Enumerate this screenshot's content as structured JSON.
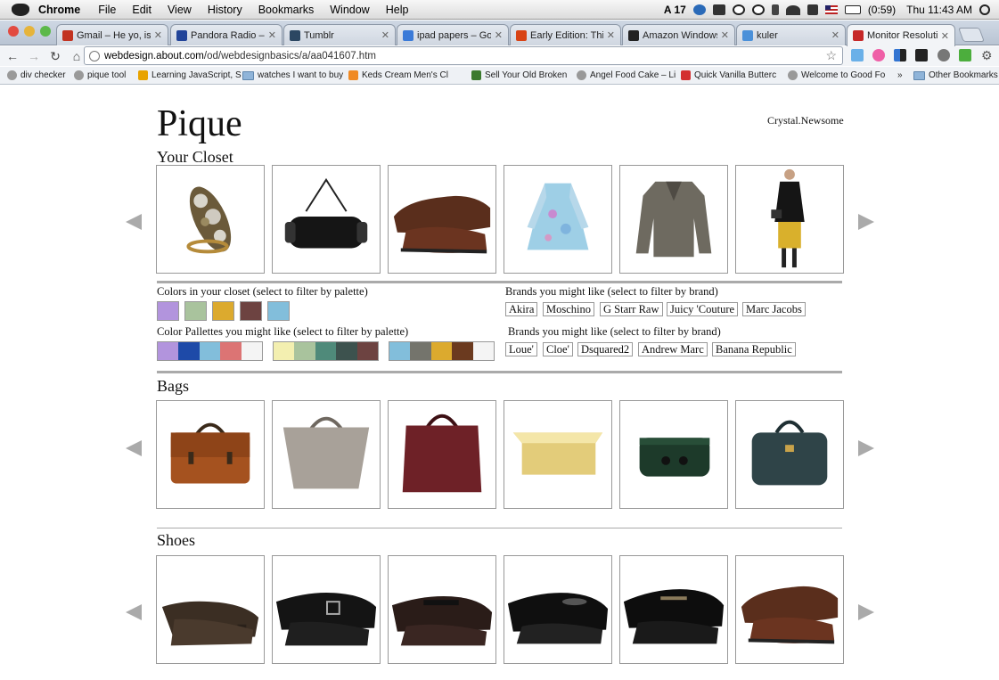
{
  "menubar": {
    "app": "Chrome",
    "items": [
      "File",
      "Edit",
      "View",
      "History",
      "Bookmarks",
      "Window",
      "Help"
    ],
    "battery": "(0:59)",
    "clock": "Thu 11:43 AM",
    "adobe_count": "17"
  },
  "tabs": [
    {
      "label": "Gmail – He yo, is the",
      "color": "#c23321"
    },
    {
      "label": "Pandora Radio – Liste",
      "color": "#224499"
    },
    {
      "label": "Tumblr",
      "color": "#2c4762"
    },
    {
      "label": "ipad papers – Google",
      "color": "#3a7ad8"
    },
    {
      "label": "Early Edition: This Go",
      "color": "#d84315"
    },
    {
      "label": "Amazon Windowshop",
      "color": "#222222"
    },
    {
      "label": "kuler",
      "color": "#4a90d9"
    },
    {
      "label": "Monitor Resolution W",
      "color": "#c62828"
    }
  ],
  "toolbar": {
    "url_domain": "webdesign.about.com",
    "url_path": "/od/webdesignbasics/a/aa041607.htm"
  },
  "bookmarks": [
    {
      "label": "div checker",
      "type": "globe"
    },
    {
      "label": "pique tool",
      "type": "globe"
    },
    {
      "label": "Learning JavaScript, S",
      "type": "page"
    },
    {
      "label": "watches I want to buy",
      "type": "folder"
    },
    {
      "label": "Keds Cream Men's Cl",
      "type": "orange"
    },
    {
      "label": "Sell Your Old Broken",
      "type": "money"
    },
    {
      "label": "Angel Food Cake – Li",
      "type": "globe"
    },
    {
      "label": "Quick Vanilla Butterc",
      "type": "red"
    },
    {
      "label": "Welcome to Good Fo",
      "type": "globe"
    },
    {
      "label": "»",
      "type": "none"
    },
    {
      "label": "Other Bookmarks",
      "type": "folder"
    }
  ],
  "page": {
    "logo": "Pique",
    "username": "Crystal.Newsome",
    "closet_title": "Your Closet",
    "closet_items": [
      "ring",
      "clutch-bag",
      "brown-loafer",
      "floral-dress",
      "grey-jacket",
      "model-outfit"
    ],
    "colors_label": "Colors in your closet (select to filter by palette)",
    "closet_colors": [
      "#b294dd",
      "#a9c39d",
      "#dcaa2e",
      "#6d4341",
      "#82bedb"
    ],
    "palettes_label": "Color Pallettes you might like (select to filter by palette)",
    "palettes": [
      [
        "#b294dd",
        "#1e4aa8",
        "#82bedb",
        "#dc7474",
        "#f4f4f4"
      ],
      [
        "#f3efb0",
        "#a9c39d",
        "#4f8a7a",
        "#3d524e",
        "#6d4341"
      ],
      [
        "#82bedb",
        "#74746c",
        "#dcaa2e",
        "#6b3a1f",
        "#f4f4f4"
      ]
    ],
    "brands_label": "Brands you might like (select to filter by brand)",
    "brands_row1": [
      "Akira",
      "Moschino",
      "G Starr Raw",
      "Juicy 'Couture",
      "Marc Jacobs"
    ],
    "brands_row2": [
      "Loue'",
      "Cloe'",
      "Dsquared2",
      "Andrew Marc",
      "Banana Republic"
    ],
    "bags_title": "Bags",
    "bag_items": [
      "tan-satchel",
      "grey-tote",
      "burgundy-tote",
      "gold-clutch",
      "green-clutch",
      "teal-satchel"
    ],
    "shoes_title": "Shoes",
    "shoe_items": [
      "brown-pump",
      "black-buckle-shoe",
      "black-mary-jane",
      "black-patent-flat",
      "black-loafer",
      "brown-loafer"
    ]
  }
}
